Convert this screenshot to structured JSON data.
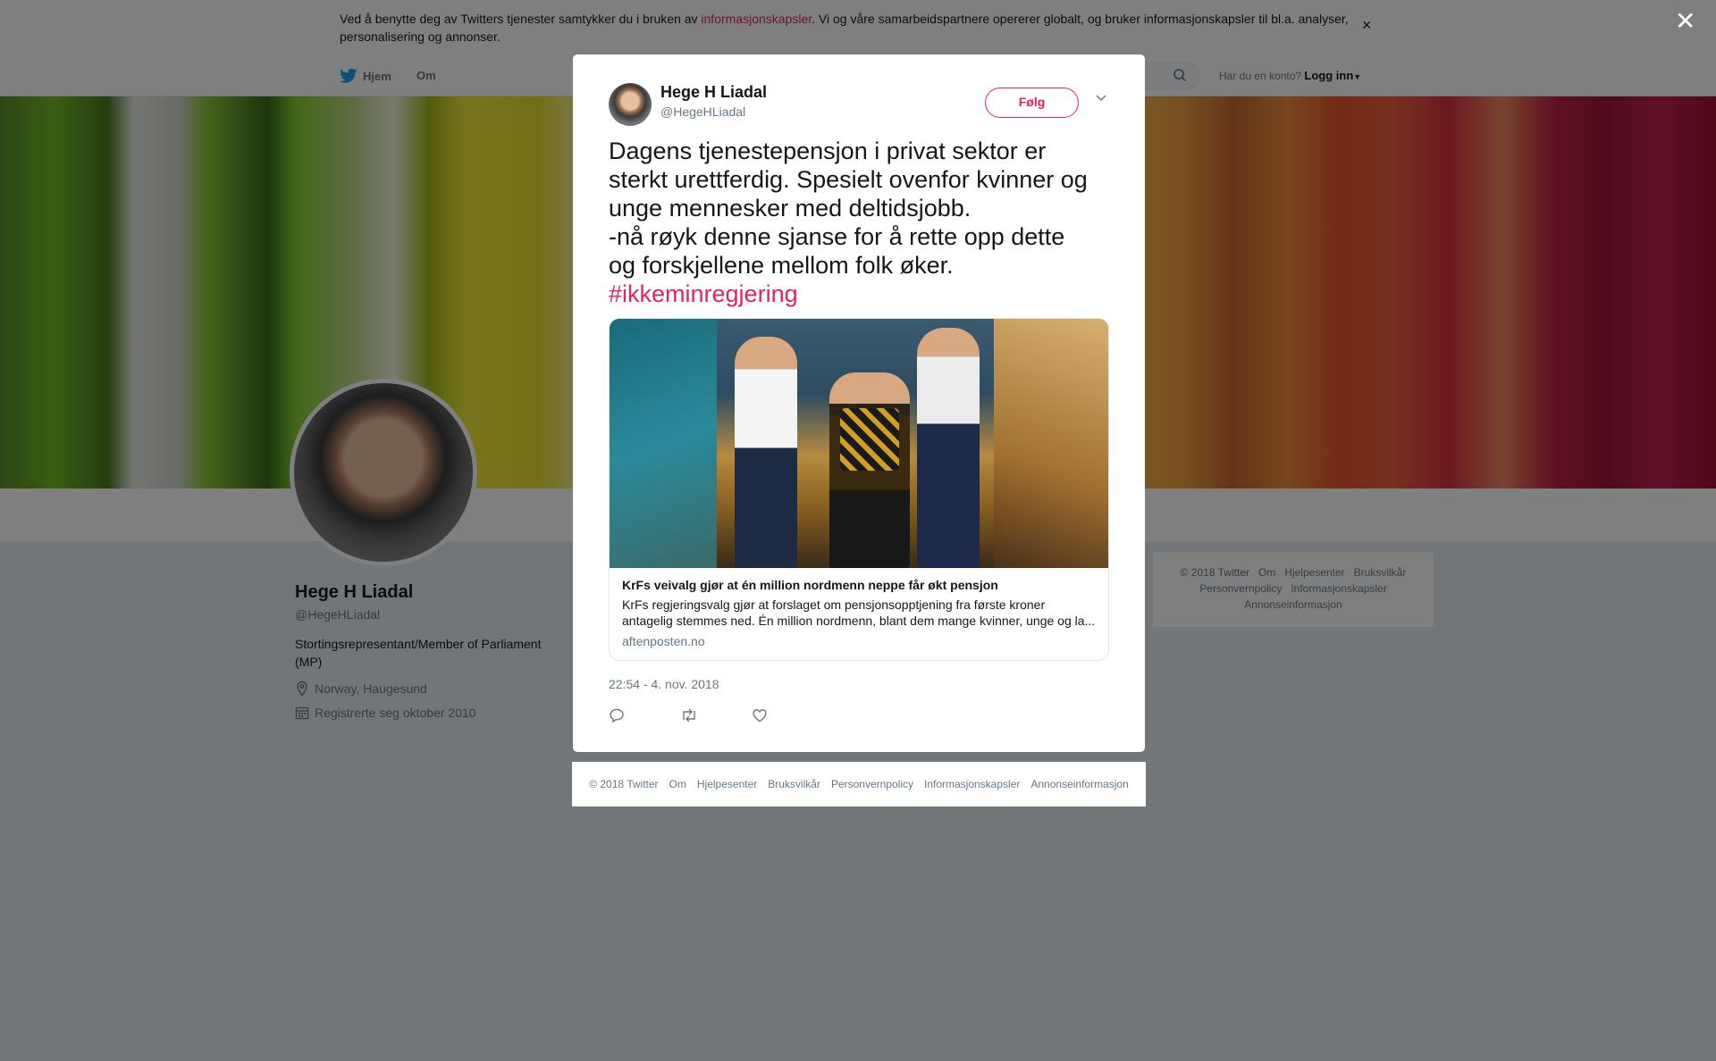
{
  "cookie_bar": {
    "text_before": "Ved å benytte deg av Twitters tjenester samtykker du i bruken av ",
    "link": "informasjonskapsler",
    "text_after": ". Vi og våre samarbeidspartnere opererer globalt, og bruker informasjonskapsler til bl.a. analyser, personalisering og annonser.",
    "close": "×"
  },
  "nav": {
    "home": "Hjem",
    "about": "Om",
    "login_prompt": "Har du en konto?",
    "login": "Logg inn"
  },
  "profile": {
    "name": "Hege H Liadal",
    "handle": "@HegeHLiadal",
    "bio": "Stortingsrepresentant/Member of Parliament (MP)",
    "location": "Norway, Haugesund",
    "joined": "Registrerte seg oktober 2010"
  },
  "side_footer": [
    "© 2018 Twitter",
    "Om",
    "Hjelpesenter",
    "Bruksvilkår",
    "Personvernpolicy",
    "Informasjonskapsler",
    "Annonseinformasjon"
  ],
  "overlay_close": "✕",
  "tweet": {
    "name": "Hege H Liadal",
    "handle": "@HegeHLiadal",
    "follow": "Følg",
    "lines": [
      "Dagens tjenestepensjon i privat sektor er",
      "sterkt urettferdig. Spesielt ovenfor kvinner og",
      "unge mennesker med deltidsjobb.",
      "-nå røyk denne sjanse for å rette opp dette",
      "og forskjellene mellom folk øker."
    ],
    "hashtag": "#ikkeminregjering",
    "card": {
      "title": "KrFs veivalg gjør at én million nordmenn neppe får økt pensjon",
      "desc_line1": "KrFs regjeringsvalg gjør at forslaget om pensjonsopptjening fra første kroner",
      "desc_line2": "antagelig stemmes ned. Én million nordmenn, blant dem mange kvinner, unge og la...",
      "domain": "aftenposten.no"
    },
    "timestamp": "22:54 - 4. nov. 2018"
  },
  "modal_footer": [
    "© 2018 Twitter",
    "Om",
    "Hjelpesenter",
    "Bruksvilkår",
    "Personvernpolicy",
    "Informasjonskapsler",
    "Annonseinformasjon"
  ],
  "colors": {
    "accent": "#e0245e",
    "secondary_text": "#657786",
    "twitter_blue": "#1da1f2"
  }
}
